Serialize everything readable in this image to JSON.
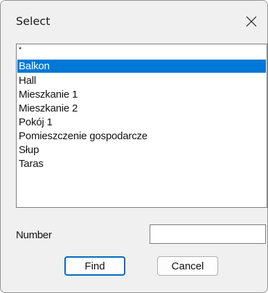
{
  "window": {
    "title": "Select"
  },
  "list": {
    "items": [
      {
        "label": "*",
        "selected": false
      },
      {
        "label": "Balkon",
        "selected": true
      },
      {
        "label": "Hall",
        "selected": false
      },
      {
        "label": "Mieszkanie 1",
        "selected": false
      },
      {
        "label": "Mieszkanie 2",
        "selected": false
      },
      {
        "label": "Pokój 1",
        "selected": false
      },
      {
        "label": "Pomieszczenie gospodarcze",
        "selected": false
      },
      {
        "label": "Słup",
        "selected": false
      },
      {
        "label": "Taras",
        "selected": false
      }
    ]
  },
  "number": {
    "label": "Number",
    "value": ""
  },
  "buttons": {
    "find_label": "Find",
    "cancel_label": "Cancel"
  },
  "icons": {
    "close": "close-icon"
  },
  "colors": {
    "selection": "#0078d7",
    "default_button_border": "#0067c0",
    "dialog_background": "#f0f0f0"
  }
}
